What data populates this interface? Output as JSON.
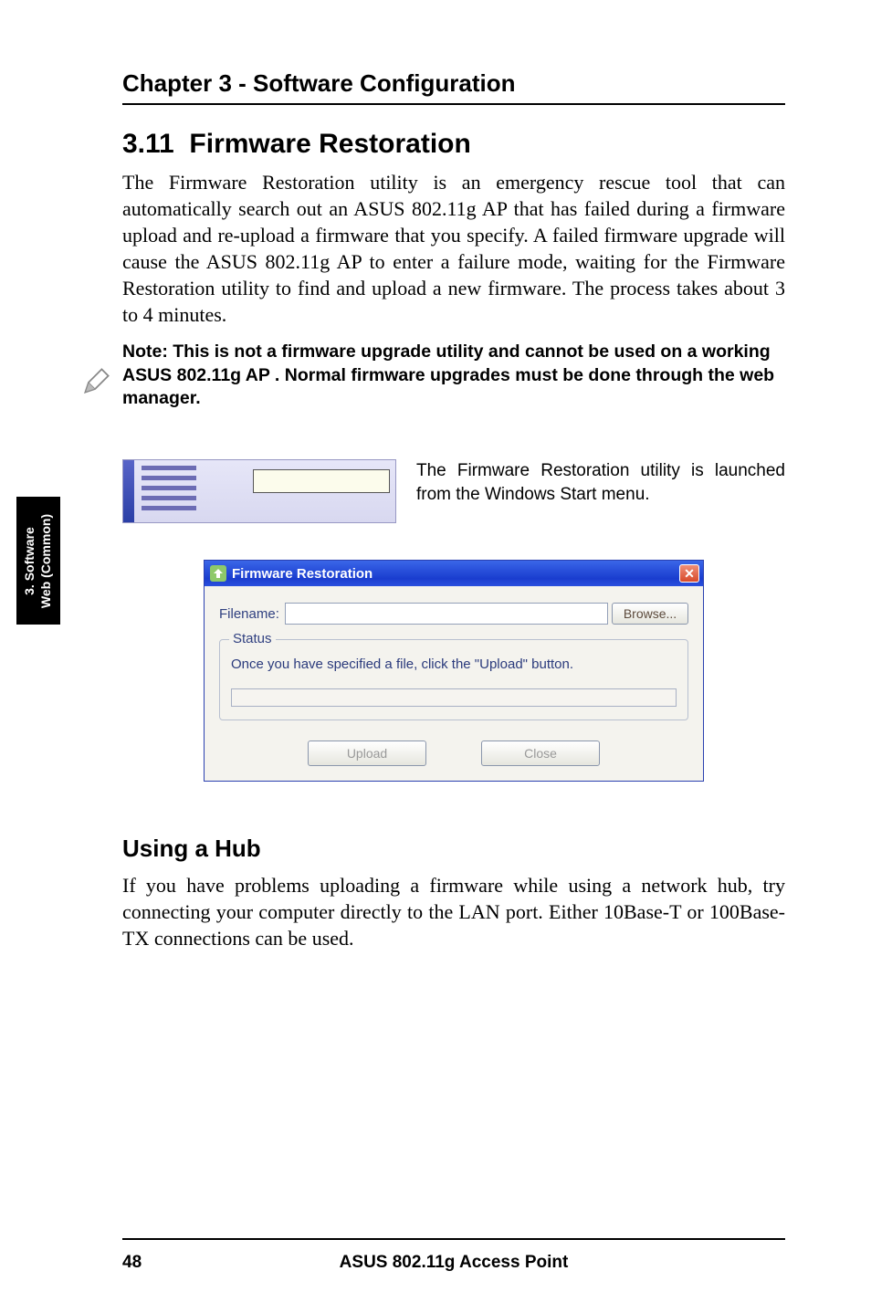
{
  "chapter": "Chapter 3 - Software Configuration",
  "section": {
    "number": "3.11",
    "title": "Firmware Restoration",
    "body": "The Firmware Restoration utility is an emergency rescue tool that can automatically search out an ASUS 802.11g AP that has failed during a firmware upload and re-upload a firmware that you specify. A failed firmware upgrade will cause the ASUS 802.11g AP to enter a failure mode, waiting for the Firmware Restoration utility to find and upload a new firmware. The process takes about 3 to 4 minutes."
  },
  "note": "Note: This is not a firmware upgrade utility and cannot be used on a working ASUS 802.11g AP . Normal firmware upgrades must be done through the web manager.",
  "side_tab": "3. Software\nWeb (Common)",
  "caption_start": "The Firmware Restoration utility is launched from the Windows Start menu.",
  "dialog": {
    "title": "Firmware Restoration",
    "filename_label": "Filename:",
    "filename_value": "",
    "browse": "Browse...",
    "status_legend": "Status",
    "status_msg": "Once you have specified a file, click the \"Upload\" button.",
    "upload": "Upload",
    "close": "Close"
  },
  "subhead": "Using a Hub",
  "hub_body": "If you have problems uploading a firmware while using a network hub, try connecting your computer directly to the LAN port. Either 10Base-T or 100Base-TX connections can be used.",
  "footer": {
    "page": "48",
    "product": "ASUS 802.11g Access Point"
  }
}
